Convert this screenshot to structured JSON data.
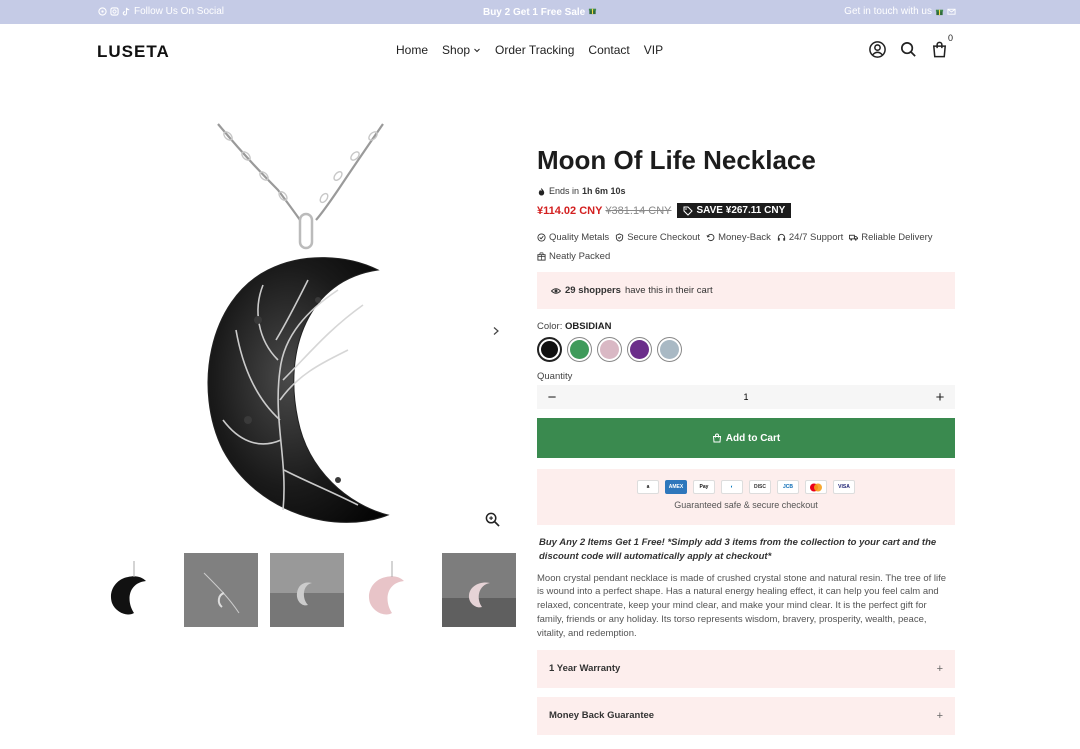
{
  "announcement": {
    "left_text": "Follow Us On Social",
    "center_text": "Buy 2 Get 1 Free Sale",
    "right_text": "Get in touch with us"
  },
  "header": {
    "logo": "LUSETA",
    "nav": [
      "Home",
      "Shop",
      "Order Tracking",
      "Contact",
      "VIP"
    ],
    "cart_count": "0"
  },
  "product": {
    "title": "Moon Of Life Necklace",
    "ends_label": "Ends in",
    "ends_time": "1h 6m 10s",
    "price_now": "¥114.02 CNY",
    "price_old": "¥381.14 CNY",
    "save_label": "SAVE ¥267.11 CNY",
    "features": [
      "Quality Metals",
      "Secure Checkout",
      "Money-Back",
      "24/7 Support",
      "Reliable Delivery",
      "Neatly Packed"
    ],
    "shoppers_count": "29 shoppers",
    "shoppers_text": "have this in their cart",
    "color_label": "Color:",
    "color_value": "OBSIDIAN",
    "swatches": [
      "#111111",
      "#3f9a5a",
      "#d9b8c4",
      "#6b2d8a",
      "#a9b9c4"
    ],
    "quantity_label": "Quantity",
    "quantity_value": "1",
    "add_to_cart": "Add to Cart",
    "payment_methods": [
      "Amazon",
      "Amex",
      "Apple Pay",
      "Diners",
      "Discover",
      "JCB",
      "Mastercard",
      "Visa"
    ],
    "payment_text": "Guaranteed safe & secure checkout",
    "promo_text": "Buy Any 2 Items Get 1 Free! *Simply add 3 items from the collection to your cart and the discount code will automatically apply at checkout*",
    "description": "Moon crystal pendant necklace is made of crushed crystal stone and natural resin. The tree of life is wound into a perfect shape. Has a natural energy healing effect, it can help you feel calm and relaxed, concentrate, keep your mind clear, and make your mind clear. It is the perfect gift for family, friends or any holiday. Its torso represents wisdom, bravery, prosperity, wealth, peace, vitality, and redemption.",
    "accordions": [
      "1 Year Warranty",
      "Money Back Guarantee"
    ]
  }
}
